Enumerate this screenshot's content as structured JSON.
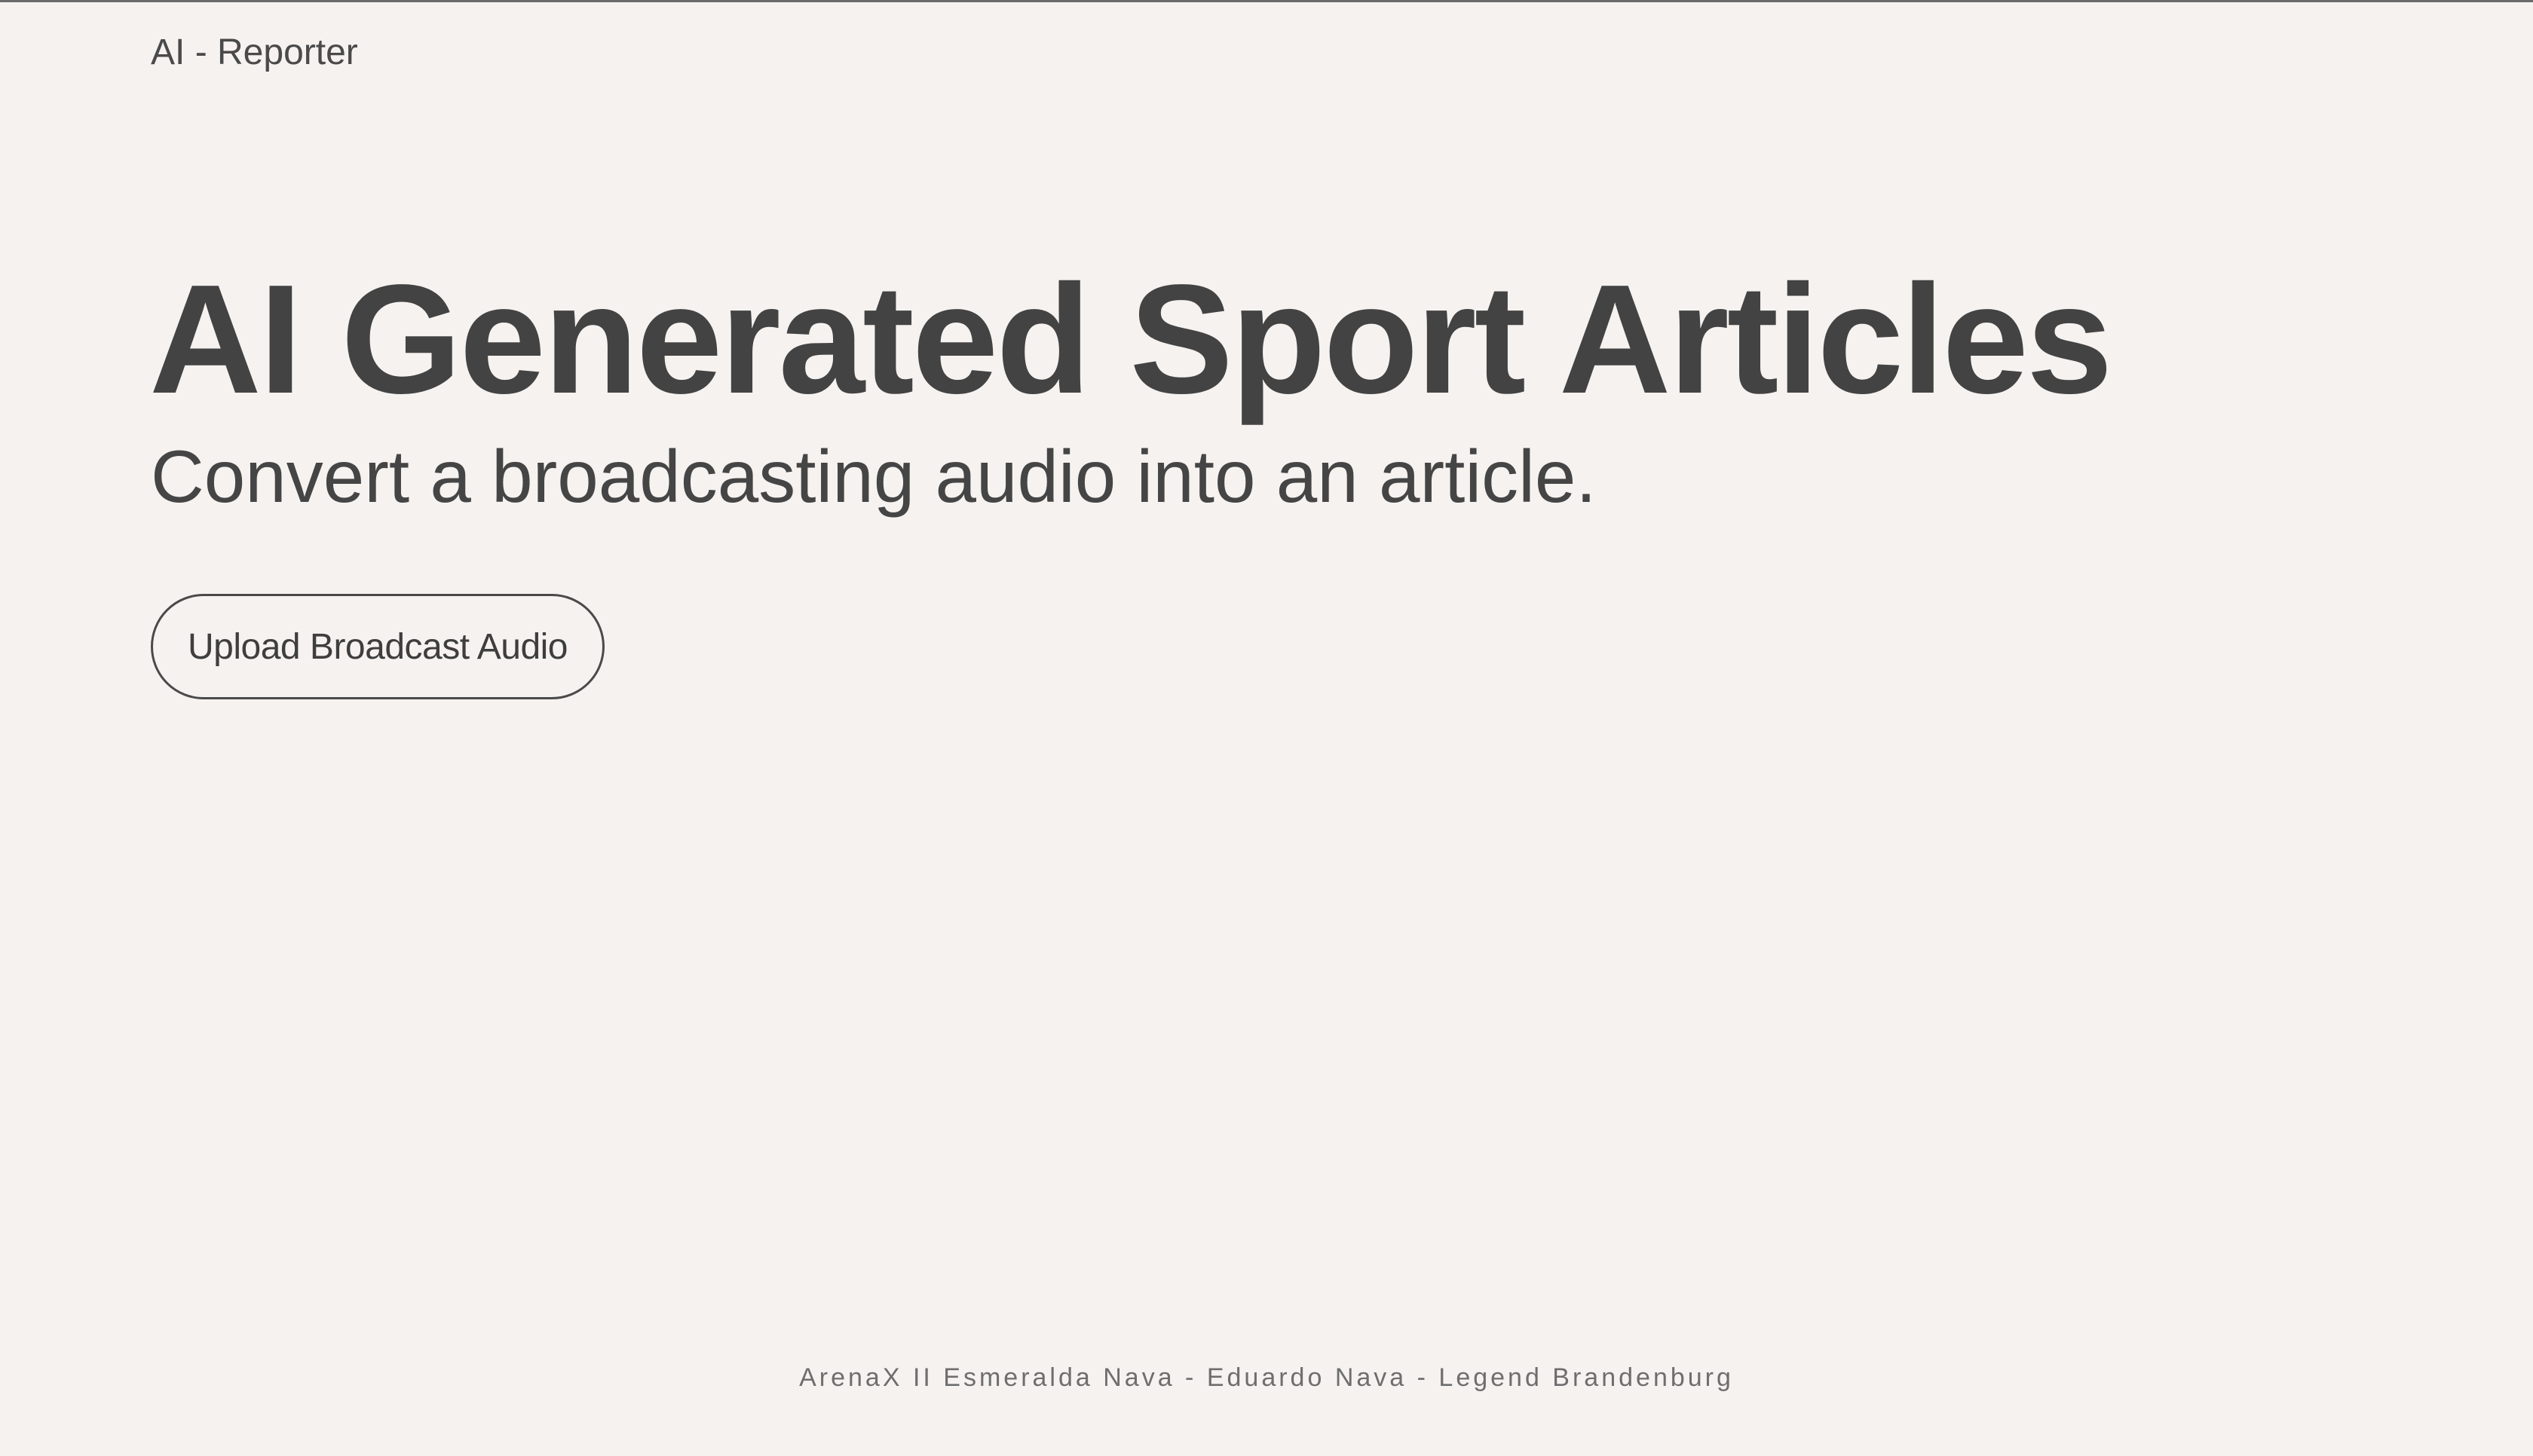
{
  "header": {
    "brand": "AI - Reporter"
  },
  "hero": {
    "title": "AI Generated Sport Articles",
    "subtitle": "Convert a broadcasting audio into an article.",
    "upload_button_label": "Upload Broadcast Audio"
  },
  "footer": {
    "credits": "ArenaX II Esmeralda Nava - Eduardo Nava - Legend Brandenburg"
  }
}
